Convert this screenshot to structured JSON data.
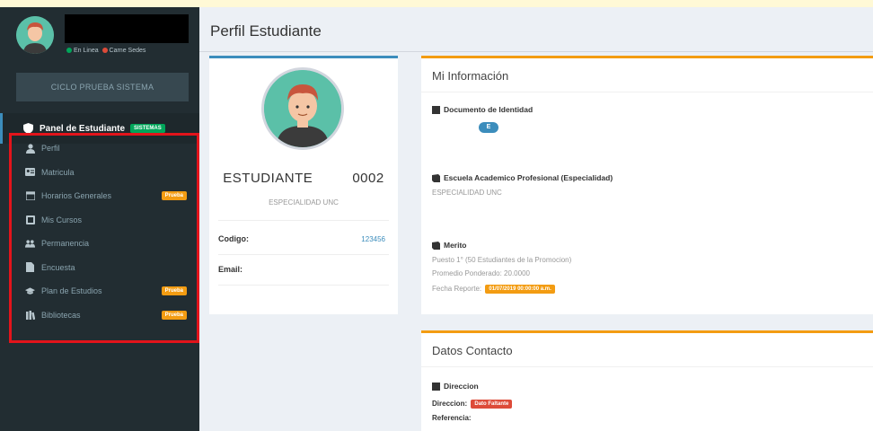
{
  "sidebar": {
    "status_online": "En Linea",
    "status_other": "Carne Sedes",
    "cycle_button": "CICLO PRUEBA SISTEMA",
    "panel_label": "Panel de Estudiante",
    "panel_badge": "SISTEMAS",
    "items": [
      {
        "label": "Perfil",
        "icon": "user-icon"
      },
      {
        "label": "Matricula",
        "icon": "id-card-icon"
      },
      {
        "label": "Horarios Generales",
        "icon": "calendar-icon",
        "badge": "Prueba"
      },
      {
        "label": "Mis Cursos",
        "icon": "book-icon"
      },
      {
        "label": "Permanencia",
        "icon": "users-icon"
      },
      {
        "label": "Encuesta",
        "icon": "file-icon"
      },
      {
        "label": "Plan de Estudios",
        "icon": "graduation-cap-icon",
        "badge": "Prueba"
      },
      {
        "label": "Bibliotecas",
        "icon": "library-icon",
        "badge": "Prueba"
      }
    ]
  },
  "header": {
    "title": "Perfil Estudiante"
  },
  "profile": {
    "name": "ESTUDIANTE",
    "number": "0002",
    "specialty": "ESPECIALIDAD UNC",
    "code_label": "Codigo:",
    "code_value": "123456",
    "email_label": "Email:"
  },
  "info": {
    "title": "Mi Información",
    "doc_title": "Documento de Identidad",
    "doc_value": "E",
    "school_title": "Escuela Academico Profesional (Especialidad)",
    "school_value": "ESPECIALIDAD UNC",
    "merit_title": "Merito",
    "merit_line1": "Puesto 1° (50 Estudiantes de la Promocion)",
    "merit_line2": "Promedio Ponderado: 20.0000",
    "merit_line3": "Fecha Reporte:",
    "merit_date": "01/07/2019 00:00:00 a.m."
  },
  "contact": {
    "title": "Datos Contacto",
    "address_title": "Direccion",
    "address_label": "Direccion:",
    "address_badge": "Dato Faltante",
    "reference_label": "Referencia:"
  },
  "colors": {
    "sidebar": "#222d32",
    "accent_blue": "#3c8dbc",
    "accent_orange": "#f39c12",
    "highlight_red": "#e3141b",
    "success_green": "#00a65a"
  }
}
